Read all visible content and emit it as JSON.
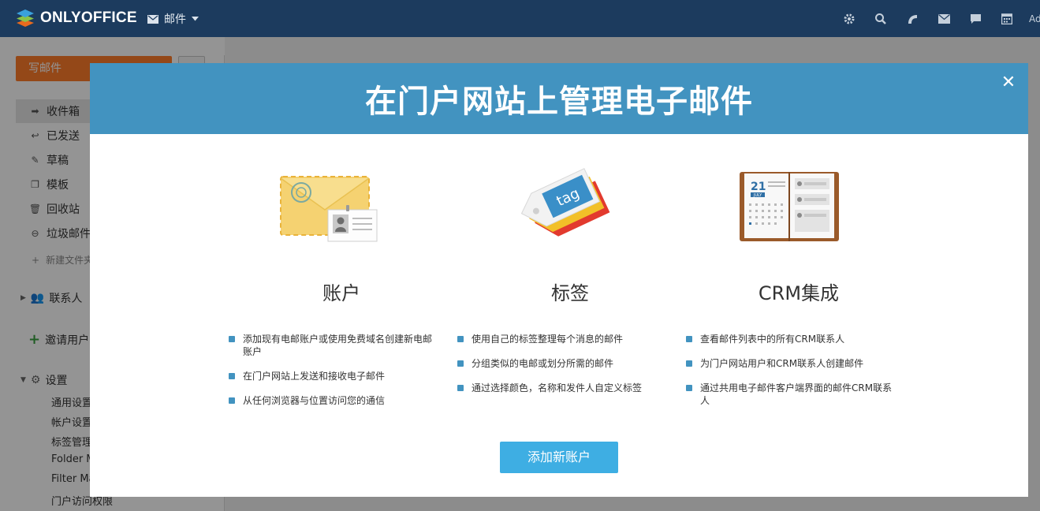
{
  "app": {
    "logo_text": "ONLYOFFICE",
    "module_label": "邮件",
    "module_icon": "envelope-icon",
    "user_initials": "Ad"
  },
  "topbar_icons": [
    "gear-icon",
    "search-icon",
    "feed-icon",
    "mail-icon",
    "chat-icon",
    "calendar-icon"
  ],
  "sidebar": {
    "compose_label": "写邮件",
    "folders": [
      {
        "label": "收件箱",
        "icon": "inbox-arrow-icon",
        "active": true
      },
      {
        "label": "已发送",
        "icon": "reply-icon"
      },
      {
        "label": "草稿",
        "icon": "edit-icon"
      },
      {
        "label": "模板",
        "icon": "template-icon"
      },
      {
        "label": "回收站",
        "icon": "trash-icon"
      },
      {
        "label": "垃圾邮件",
        "icon": "spam-icon"
      }
    ],
    "new_folder_label": "新建文件夹",
    "contacts_label": "联系人",
    "invite_label": "邀请用户",
    "settings_label": "设置",
    "settings_items": [
      "通用设置",
      "帐户设置",
      "标签管理",
      "Folder M",
      "Filter Ma",
      "门户访问权限"
    ]
  },
  "modal": {
    "title": "在门户网站上管理电子邮件",
    "close_label": "✕",
    "features": [
      {
        "title": "账户",
        "icon": "envelope-illustration",
        "bullets": [
          "添加现有电邮账户或使用免费域名创建新电邮账户",
          "在门户网站上发送和接收电子邮件",
          "从任何浏览器与位置访问您的通信"
        ]
      },
      {
        "title": "标签",
        "icon": "tag-illustration",
        "tag_text": "tag",
        "bullets": [
          "使用自己的标签整理每个消息的邮件",
          "分组类似的电邮或划分所需的邮件",
          "通过选择颜色，名称和发件人自定义标签"
        ]
      },
      {
        "title": "CRM集成",
        "icon": "organizer-illustration",
        "calendar_day": "21",
        "calendar_month": "JULY",
        "bullets": [
          "查看邮件列表中的所有CRM联系人",
          "为门户网站用户和CRM联系人创建邮件",
          "通过共用电子邮件客户端界面的邮件CRM联系人"
        ]
      }
    ],
    "add_account_label": "添加新账户"
  },
  "colors": {
    "topbar": "#1c3b5e",
    "modal_header": "#4293c0",
    "primary_button": "#3eaee3",
    "compose_button": "#ff7c2a"
  }
}
